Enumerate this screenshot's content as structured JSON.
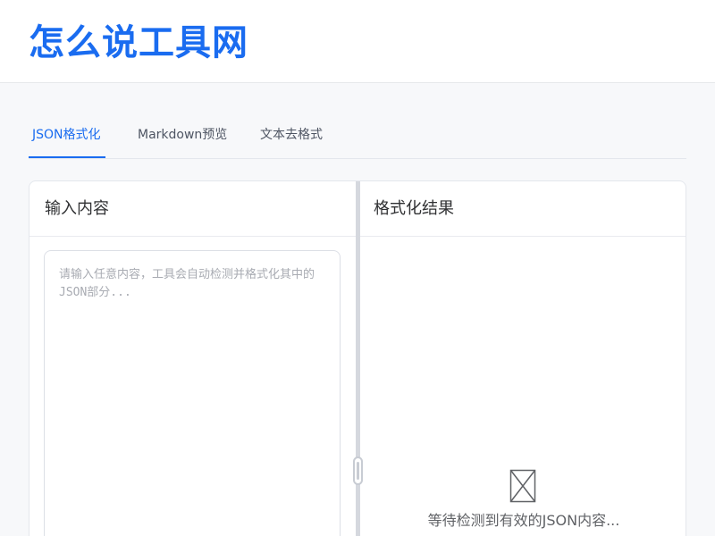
{
  "header": {
    "logo_text": "怎么说工具网"
  },
  "tabs": [
    {
      "label": "JSON格式化",
      "active": true
    },
    {
      "label": "Markdown预览",
      "active": false
    },
    {
      "label": "文本去格式",
      "active": false
    }
  ],
  "input_pane": {
    "title": "输入内容",
    "textarea": {
      "value": "",
      "placeholder": "请输入任意内容，工具会自动检测并格式化其中的JSON部分..."
    }
  },
  "output_pane": {
    "title": "格式化结果",
    "empty_icon": "broken-image-icon",
    "empty_text": "等待检测到有效的JSON内容..."
  },
  "colors": {
    "accent": "#1a6cf0",
    "background": "#f7f8fa",
    "border": "#e4e7ed"
  }
}
